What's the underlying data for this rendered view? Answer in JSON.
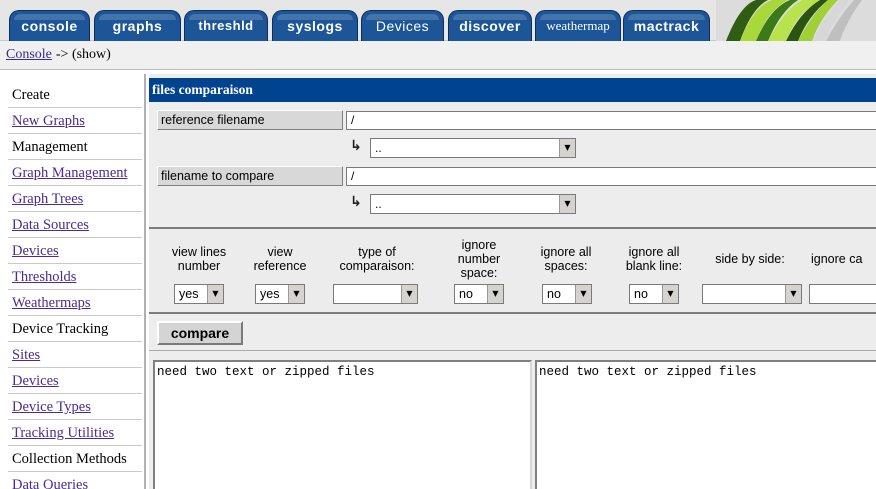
{
  "tabs": [
    {
      "label": "console"
    },
    {
      "label": "graphs"
    },
    {
      "label": "threshld"
    },
    {
      "label": "syslogs"
    },
    {
      "label": "Devices"
    },
    {
      "label": "discover"
    },
    {
      "label": "weathermap"
    },
    {
      "label": "mactrack"
    }
  ],
  "colors": {
    "tab_blue": "#1c5598",
    "header_blue": "#00438f",
    "link_purple": "#4b2b8f"
  },
  "breadcrumb": {
    "link": "Console",
    "rest": "-> (show)"
  },
  "sidebar": {
    "items": [
      {
        "label": "Create",
        "type": "heading"
      },
      {
        "label": "New Graphs",
        "type": "link"
      },
      {
        "label": "Management",
        "type": "heading"
      },
      {
        "label": "Graph Management",
        "type": "link"
      },
      {
        "label": "Graph Trees",
        "type": "link"
      },
      {
        "label": "Data Sources",
        "type": "link"
      },
      {
        "label": "Devices",
        "type": "link"
      },
      {
        "label": "Thresholds",
        "type": "link"
      },
      {
        "label": "Weathermaps",
        "type": "link"
      },
      {
        "label": "Device Tracking",
        "type": "heading"
      },
      {
        "label": "Sites",
        "type": "link"
      },
      {
        "label": "Devices",
        "type": "link"
      },
      {
        "label": "Device Types",
        "type": "link"
      },
      {
        "label": "Tracking Utilities",
        "type": "link"
      },
      {
        "label": "Collection Methods",
        "type": "heading"
      },
      {
        "label": "Data Queries",
        "type": "link"
      }
    ]
  },
  "main": {
    "section_title": "files comparaison",
    "reference": {
      "button": "reference filename",
      "path": "/",
      "dir_select": ".."
    },
    "compare_file": {
      "button": "filename to compare",
      "path": "/",
      "dir_select": ".."
    },
    "options": [
      {
        "label": "view lines number",
        "value": "yes"
      },
      {
        "label": "view reference",
        "value": "yes"
      },
      {
        "label": "type of comparaison:",
        "value": ""
      },
      {
        "label": "ignore number space:",
        "value": "no"
      },
      {
        "label": "ignore all spaces:",
        "value": "no"
      },
      {
        "label": "ignore all blank line:",
        "value": "no"
      },
      {
        "label": "side by side:",
        "value": ""
      },
      {
        "label": "ignore ca",
        "value": ""
      }
    ],
    "compare_button": "compare",
    "left_pane": "need two text or zipped files",
    "right_pane": "need two text or zipped files"
  },
  "icons": {
    "subdir_arrow": "return-arrow-icon",
    "dropdown": "chevron-down-icon"
  }
}
